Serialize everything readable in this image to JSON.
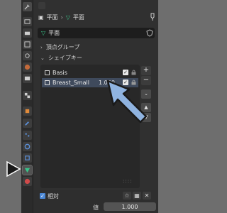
{
  "breadcrumb": {
    "object": "平面",
    "mesh": "平面"
  },
  "mesh_name": {
    "value": "平面"
  },
  "sections": {
    "vertex_groups": "頂点グループ",
    "shape_keys": "シェイプキー"
  },
  "shape_keys": [
    {
      "name": "Basis",
      "value": ""
    },
    {
      "name": "Breast_Small",
      "value": "1.000"
    }
  ],
  "footer": {
    "relative_label": "相対",
    "value_label": "値",
    "value": "1.000"
  },
  "colors": {
    "accent": "#4a87d6",
    "arrow": "#8fb3e0",
    "selected_row": "#3f4a5c"
  }
}
